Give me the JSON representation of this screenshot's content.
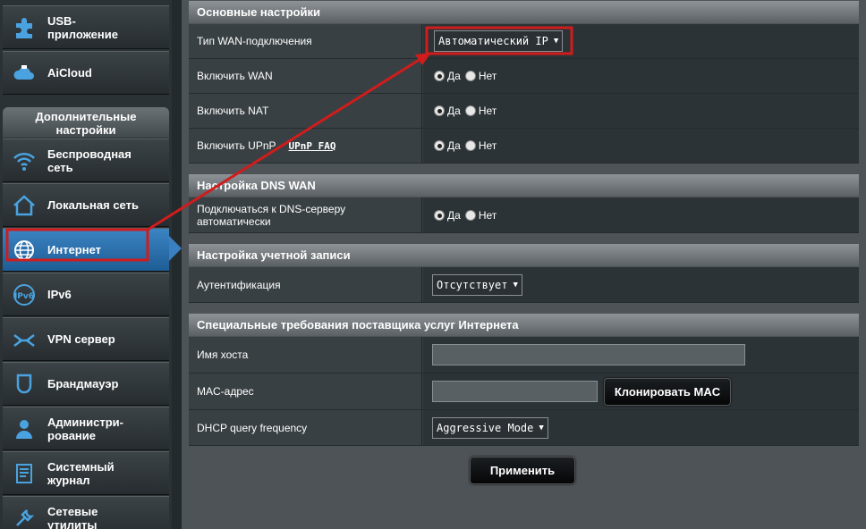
{
  "sidebar": {
    "items_top": [
      {
        "label": "USB-\nприложение",
        "icon": "puzzle-icon"
      },
      {
        "label": "AiCloud",
        "icon": "cloud-icon"
      }
    ],
    "advanced_header": "Дополнительные\nнастройки",
    "items": [
      {
        "label": "Беспроводная\nсеть",
        "icon": "wifi-icon"
      },
      {
        "label": "Локальная сеть",
        "icon": "home-icon"
      },
      {
        "label": "Интернет",
        "icon": "globe-icon"
      },
      {
        "label": "IPv6",
        "icon": "ipv6-icon"
      },
      {
        "label": "VPN сервер",
        "icon": "vpn-icon"
      },
      {
        "label": "Брандмауэр",
        "icon": "shield-icon"
      },
      {
        "label": "Администри-\nрование",
        "icon": "admin-icon"
      },
      {
        "label": "Системный\nжурнал",
        "icon": "log-icon"
      },
      {
        "label": "Сетевые\nутилиты",
        "icon": "tools-icon"
      }
    ]
  },
  "basic": {
    "title": "Основные настройки",
    "wan_type_label": "Тип WAN-подключения",
    "wan_type_value": "Автоматический IP",
    "enable_wan_label": "Включить WAN",
    "enable_nat_label": "Включить NAT",
    "enable_upnp_label": "Включить UPnP",
    "upnp_faq": "UPnP FAQ"
  },
  "dns": {
    "title": "Настройка DNS WAN",
    "auto_dns_label": "Подключаться к DNS-серверу автоматически"
  },
  "account": {
    "title": "Настройка учетной записи",
    "auth_label": "Аутентификация",
    "auth_value": "Отсутствует"
  },
  "isp": {
    "title": "Специальные требования поставщика услуг Интернета",
    "hostname_label": "Имя хоста",
    "mac_label": "MAC-адрес",
    "clone_mac": "Клонировать MAC",
    "dhcp_label": "DHCP query frequency",
    "dhcp_value": "Aggressive Mode"
  },
  "radio": {
    "yes": "Да",
    "no": "Нет"
  },
  "apply": "Применить",
  "colors": {
    "highlight": "#d01c1c",
    "active": "#2e72b0"
  }
}
